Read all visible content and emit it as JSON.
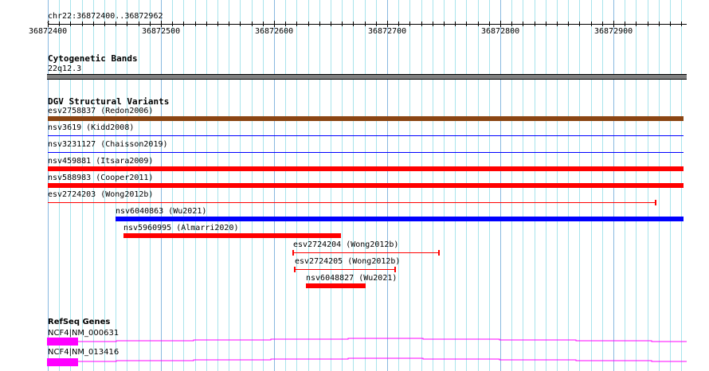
{
  "ruler": {
    "location": "chr22:36872400..36872962",
    "start": 36872400,
    "end": 36872962,
    "tick_labels": [
      "36872400",
      "36872500",
      "36872600",
      "36872700",
      "36872800",
      "36872900"
    ]
  },
  "cytoband": {
    "title": "Cytogenetic Bands",
    "band": "22q12.3",
    "color": "#808080"
  },
  "dgv": {
    "title": "DGV Structural Variants",
    "variants": [
      {
        "label": "esv2758837 (Redon2006)",
        "start": 36872400,
        "end": 36872962,
        "style": "bar",
        "color": "#8b4513",
        "row": 0
      },
      {
        "label": "nsv3619 (Kidd2008)",
        "start": 36872400,
        "end": 36872962,
        "style": "thin",
        "color": "#0000ff",
        "row": 1
      },
      {
        "label": "nsv3231127 (Chaisson2019)",
        "start": 36872400,
        "end": 36872962,
        "style": "thin",
        "color": "#0000ff",
        "row": 2
      },
      {
        "label": "nsv459881 (Itsara2009)",
        "start": 36872400,
        "end": 36872962,
        "style": "bar",
        "color": "#ff0000",
        "row": 3
      },
      {
        "label": "nsv588983 (Cooper2011)",
        "start": 36872400,
        "end": 36872962,
        "style": "bar",
        "color": "#ff0000",
        "row": 4
      },
      {
        "label": "esv2724203 (Wong2012b)",
        "start": 36872400,
        "end": 36872937,
        "style": "line",
        "color": "#ff0000",
        "row": 5
      },
      {
        "label": "nsv6040863 (Wu2021)",
        "start": 36872460,
        "end": 36872962,
        "style": "bar",
        "color": "#0000ff",
        "row": 6
      },
      {
        "label": "nsv5960995 (Almarri2020)",
        "start": 36872467,
        "end": 36872659,
        "style": "bar",
        "color": "#ff0000",
        "row": 7
      },
      {
        "label": "esv2724204 (Wong2012b)",
        "start": 36872617,
        "end": 36872746,
        "style": "line",
        "color": "#ff0000",
        "row": 8
      },
      {
        "label": "esv2724205 (Wong2012b)",
        "start": 36872618,
        "end": 36872707,
        "style": "line",
        "color": "#ff0000",
        "row": 9
      },
      {
        "label": "nsv6048827 (Wu2021)",
        "start": 36872628,
        "end": 36872681,
        "style": "bar",
        "color": "#ff0000",
        "row": 10
      }
    ]
  },
  "refseq": {
    "title": "RefSeq Genes",
    "color": "#ff00ff",
    "genes": [
      {
        "label": "NCF4|NM_000631"
      },
      {
        "label": "NCF4|NM_013416"
      }
    ]
  }
}
